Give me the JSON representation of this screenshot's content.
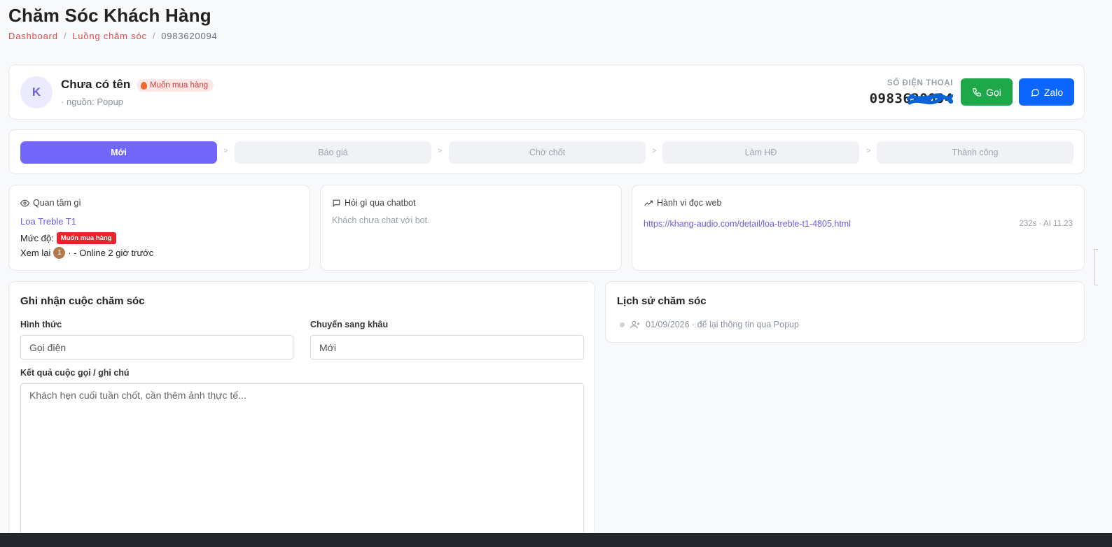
{
  "page": {
    "title": "Chăm Sóc Khách Hàng",
    "breadcrumb": [
      "Dashboard",
      "Luồng chăm sóc",
      "0983620094"
    ]
  },
  "customer": {
    "avatar_initial": "K",
    "name": "Chưa có tên",
    "badge": "Muốn mua hàng",
    "source": "· nguồn: Popup",
    "phone_label": "SỐ ĐIỆN THOẠI",
    "phone_number": "0983620094",
    "call_label": "Gọi",
    "zalo_label": "Zalo"
  },
  "pipeline": {
    "stages": [
      "Mới",
      "Báo giá",
      "Chờ chốt",
      "Làm HĐ",
      "Thành công"
    ],
    "active_index": 0
  },
  "interest": {
    "title": "Quan tâm gì",
    "product": "Loa Treble T1",
    "level_label": "Mức độ:",
    "level_tag": "Muốn mua hàng",
    "seen_label": "Xem lại",
    "seen_count": "1",
    "online_text": "· - Online 2 giờ trước"
  },
  "chatbot": {
    "title": "Hỏi gì qua chatbot",
    "empty_text": "Khách chưa chat với bot."
  },
  "web": {
    "title": "Hành vi đọc web",
    "url": "https://khang-audio.com/detail/loa-treble-t1-4805.html",
    "meta": "232s · AI 11.23"
  },
  "record": {
    "title": "Ghi nhận cuộc chăm sóc",
    "method_label": "Hình thức",
    "method_value": "Gọi điện",
    "stage_label": "Chuyển sang khâu",
    "stage_value": "Mới",
    "note_label": "Kết quả cuộc gọi / ghi chú",
    "note_placeholder": "Khách hẹn cuối tuần chốt, cần thêm ảnh thực tế..."
  },
  "history": {
    "title": "Lịch sử chăm sóc",
    "items": [
      {
        "text": "01/09/2026 · để lại thông tin qua Popup"
      }
    ]
  },
  "colors": {
    "accent": "#7366fb",
    "danger": "#e5484d",
    "call_green": "#1fa84a",
    "zalo_blue": "#0a66ff"
  }
}
